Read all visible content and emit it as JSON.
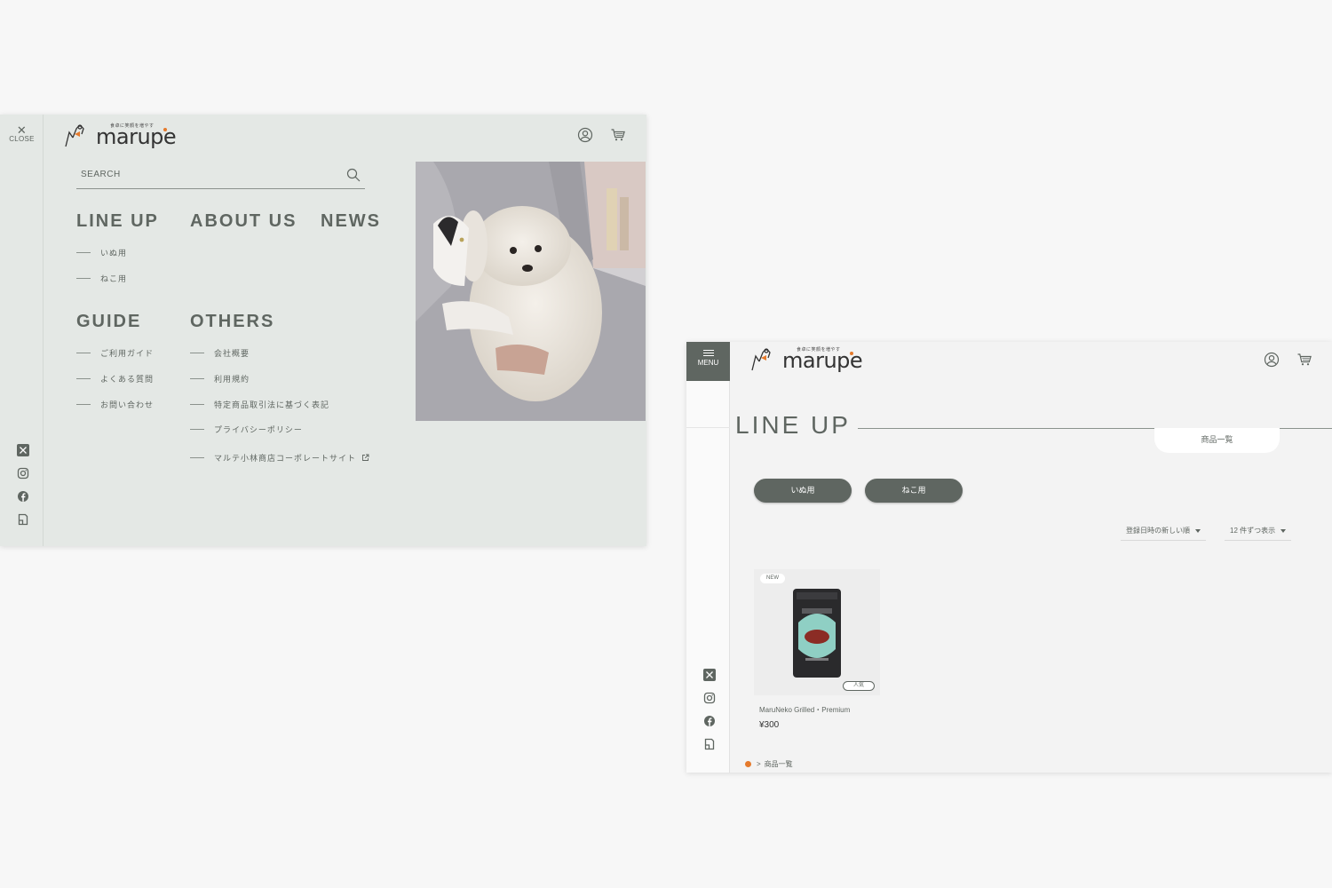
{
  "menu_screen": {
    "close_label": "CLOSE",
    "logo": {
      "tagline": "食卓に笑顔を増やす",
      "wordmark": "marupe"
    },
    "search": {
      "placeholder": "SEARCH"
    },
    "nav": {
      "lineup": {
        "heading": "LINE UP",
        "items": [
          "いぬ用",
          "ねこ用"
        ]
      },
      "about": {
        "heading": "ABOUT US"
      },
      "news": {
        "heading": "NEWS"
      },
      "guide": {
        "heading": "GUIDE",
        "items": [
          "ご利用ガイド",
          "よくある質問",
          "お問い合わせ"
        ]
      },
      "others": {
        "heading": "OTHERS",
        "items": [
          "会社概要",
          "利用規約",
          "特定商品取引法に基づく表記",
          "プライバシーポリシー",
          "マルテ小林商店コーポレートサイト"
        ]
      }
    },
    "sns_icons": [
      "x-icon",
      "instagram-icon",
      "facebook-icon",
      "note-icon"
    ],
    "header_icons": [
      "account-icon",
      "cart-icon"
    ]
  },
  "lineup_screen": {
    "menu_label": "MENU",
    "logo": {
      "tagline": "食卓に笑顔を増やす",
      "wordmark": "marupe"
    },
    "page_title": "LINE UP",
    "tab_label": "商品一覧",
    "categories": [
      "いぬ用",
      "ねこ用"
    ],
    "sort_select": "登録日時の新しい順",
    "count_select": "12 件ずつ表示",
    "products": [
      {
        "badge_new": "NEW",
        "badge_popular": "人気",
        "name": "MaruNeko Grilled・Premium",
        "price": "¥300"
      }
    ],
    "breadcrumb": "商品一覧",
    "sns_icons": [
      "x-icon",
      "instagram-icon",
      "facebook-icon",
      "note-icon"
    ],
    "header_icons": [
      "account-icon",
      "cart-icon"
    ]
  },
  "colors": {
    "primary": "#5f6661",
    "accent": "#e57a2c",
    "menu_bg": "#e4e8e5",
    "page_bg": "#f7f7f7"
  }
}
